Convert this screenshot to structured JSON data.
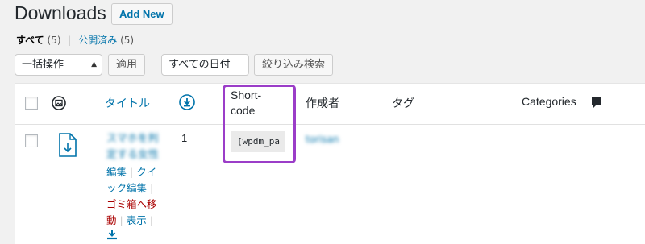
{
  "header": {
    "title": "Downloads",
    "add_new": "Add New"
  },
  "filters": {
    "all_label": "すべて",
    "all_count": "(5)",
    "published_label": "公開済み",
    "published_count": "(5)"
  },
  "toolbar": {
    "bulk_action": "一括操作",
    "apply": "適用",
    "all_dates": "すべての日付",
    "filter": "絞り込み検索"
  },
  "columns": {
    "title": "タイトル",
    "shortcode_line1": "Short-",
    "shortcode_line2": "code",
    "author": "作成者",
    "tags": "タグ",
    "categories": "Categories"
  },
  "row": {
    "title_line1": "スマホを判",
    "title_line2": "定する女性",
    "downloads": "1",
    "shortcode": "[wpdm_pa",
    "author": "torisan",
    "tags": "—",
    "categories": "—",
    "comments": "—",
    "actions": {
      "edit": "編集",
      "quick_edit_1": "クイ",
      "quick_edit_2": "ック編集",
      "trash_1": "ゴミ箱へ移",
      "trash_2": "動",
      "view": "表示"
    }
  },
  "colors": {
    "link": "#0073aa",
    "highlight": "#9b3dc8",
    "trash": "#aa0000"
  },
  "icons": [
    "image-icon",
    "download-icon",
    "file-download-icon",
    "comment-icon",
    "select-arrow-icon"
  ]
}
